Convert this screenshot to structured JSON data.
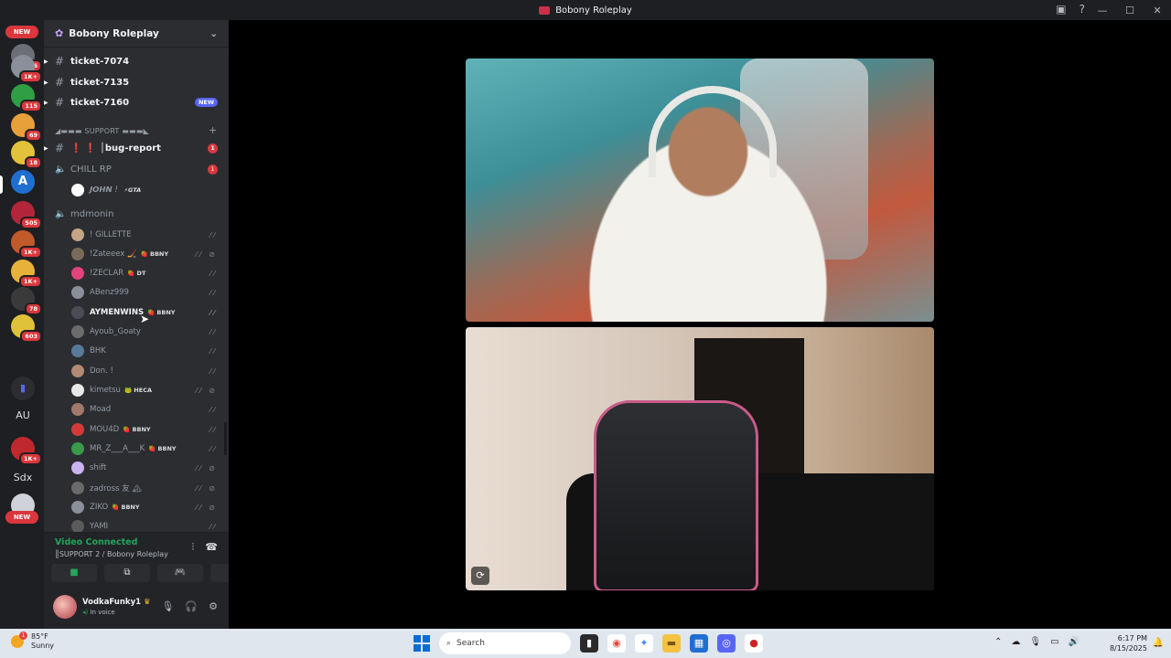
{
  "window": {
    "title": "Bobony Roleplay"
  },
  "guilds": {
    "new_top": "NEW",
    "new_bottom": "NEW",
    "badges": [
      "676",
      "1K+",
      "115",
      "69",
      "18",
      "505",
      "1K+",
      "1K+",
      "78",
      "603",
      "1K+"
    ],
    "text_items": [
      "AU",
      "Sdx"
    ]
  },
  "server": {
    "name": "Bobony Roleplay"
  },
  "channels": [
    {
      "name": "ticket-7074"
    },
    {
      "name": "ticket-7135"
    },
    {
      "name": "ticket-7160",
      "badge": "NEW"
    }
  ],
  "category_support": "◢▬▬▬ SUPPORT ▬▬▬◣",
  "bug_report": {
    "name": "❗ ❗ │bug-report",
    "badge": "1"
  },
  "voice_chill": {
    "name": "CHILL RP",
    "badge": "1",
    "member": "𝙅𝙊𝙃𝙉 !",
    "member_tag": "⚡GTA"
  },
  "voice_mdmonin": {
    "name": "mdmonin"
  },
  "members": [
    {
      "name": "! GILLETTE",
      "tag": "",
      "icons": "⁄⁄"
    },
    {
      "name": "!Zateeex 🏒",
      "tag": "🍓 BBNY",
      "icons": "⁄⁄ ⊘"
    },
    {
      "name": "!ZECLAR",
      "tag": "🍓 DT",
      "icons": "⁄⁄"
    },
    {
      "name": "ABenz999",
      "tag": "",
      "icons": "⁄⁄"
    },
    {
      "name": "AYMENWINS",
      "tag": "🍓 BBNY",
      "icons": "⁄⁄"
    },
    {
      "name": "Ayoub_Goaty",
      "tag": "",
      "icons": "⁄⁄"
    },
    {
      "name": "BHK",
      "tag": "",
      "icons": "⁄⁄"
    },
    {
      "name": "Don. !",
      "tag": "",
      "icons": "⁄⁄"
    },
    {
      "name": "kimetsu",
      "tag": "🐸 HECA",
      "icons": "⁄⁄ ⊘"
    },
    {
      "name": "Moad",
      "tag": "",
      "icons": "⁄⁄"
    },
    {
      "name": "MOU4D",
      "tag": "🍓 BBNY",
      "icons": "⁄⁄"
    },
    {
      "name": "MR_Z___A___K",
      "tag": "🍓 BBNY",
      "icons": "⁄⁄"
    },
    {
      "name": "shift",
      "tag": "",
      "icons": "⁄⁄ ⊘"
    },
    {
      "name": "zadross 友 🏔",
      "tag": "",
      "icons": "⁄⁄ ⊘"
    },
    {
      "name": "ZIKO",
      "tag": "🍓 BBNY",
      "icons": "⁄⁄ ⊘"
    },
    {
      "name": "YAMI",
      "tag": "",
      "icons": "⁄⁄"
    }
  ],
  "voice_status": {
    "connected": "Video Connected",
    "location": "║SUPPORT 2 / Bobony Roleplay"
  },
  "user": {
    "name": "VodkaFunky1",
    "status": "In voice"
  },
  "taskbar": {
    "temp": "85°F",
    "condition": "Sunny",
    "search_placeholder": "Search",
    "time": "6:17 PM",
    "date": "8/15/2025",
    "weather_badge": "1"
  },
  "colors": {
    "accent": "#5865f2",
    "danger": "#da373c",
    "online": "#23a55a"
  }
}
